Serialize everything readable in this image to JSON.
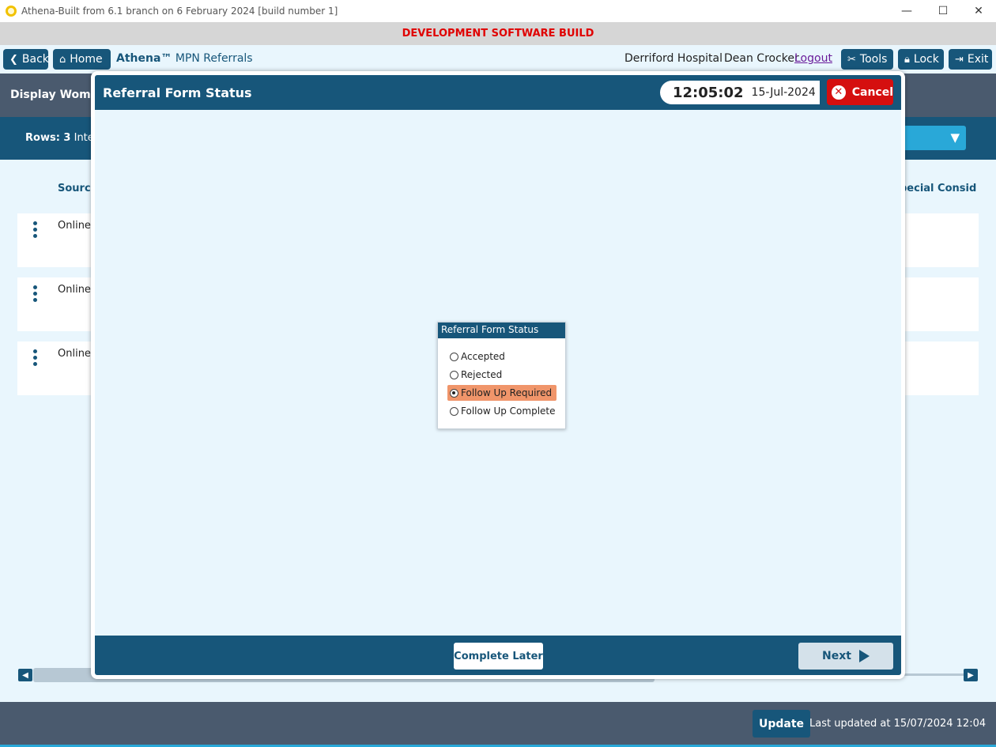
{
  "window": {
    "title": "Athena-Built from 6.1 branch on 6 February 2024 [build number 1]",
    "minimize": "—",
    "maximize": "☐",
    "close": "✕"
  },
  "banner": "DEVELOPMENT SOFTWARE BUILD",
  "nav": {
    "back": "Back",
    "home": "Home",
    "brand": "Athena™",
    "module": "MPN Referrals",
    "hospital": "Derriford Hospital",
    "user": "Dean Crocker",
    "logout": "Logout",
    "tools": "Tools",
    "lock": "Lock",
    "exit": "Exit"
  },
  "background": {
    "header": "Display Women...",
    "rows_label": "Rows: 3",
    "rows_extra": "Inte",
    "col_source": "Source",
    "col_special": "pecial Consid",
    "rows": [
      {
        "source": "Online"
      },
      {
        "source": "Online"
      },
      {
        "source": "Online"
      }
    ]
  },
  "footer": {
    "update": "Update",
    "last_updated": "Last updated at 15/07/2024 12:04"
  },
  "modal": {
    "title": "Referral Form Status",
    "time": "12:05:02",
    "date": "15-Jul-2024",
    "cancel": "Cancel",
    "status_box_title": "Referral Form Status",
    "options": [
      {
        "label": "Accepted",
        "selected": false
      },
      {
        "label": "Rejected",
        "selected": false
      },
      {
        "label": "Follow Up Required",
        "selected": true
      },
      {
        "label": "Follow Up Complete",
        "selected": false
      }
    ],
    "complete_later": "Complete Later",
    "next": "Next"
  }
}
